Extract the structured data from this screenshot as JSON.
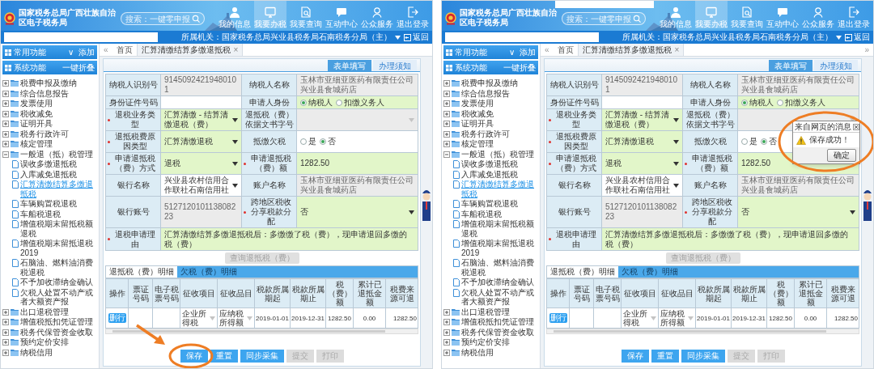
{
  "screens": [
    {
      "header": {
        "title": "国家税务总局广西壮族自治区电子税务局",
        "search_placeholder": "搜索：一键零申报",
        "redacted": false,
        "nav": [
          {
            "label": "我的信息",
            "selected": false
          },
          {
            "label": "我要办税",
            "selected": true
          },
          {
            "label": "我要查询",
            "selected": false
          },
          {
            "label": "互动中心",
            "selected": false
          },
          {
            "label": "公众服务",
            "selected": false
          },
          {
            "label": "退出登录",
            "selected": false
          }
        ]
      },
      "org_bar": {
        "label": "所属机关：国家税务总局兴业县税务局石南税务分局（主）",
        "action": "返回"
      },
      "sidebar": {
        "common": {
          "title": "常用功能",
          "caret": "∨",
          "action": "添加"
        },
        "system": {
          "title": "系统功能",
          "action": "一键折叠"
        },
        "tree": [
          {
            "label": "税费申报及缴纳",
            "expanded": false,
            "selected": false
          },
          {
            "label": "综合信息报告",
            "expanded": false,
            "selected": false
          },
          {
            "label": "发票使用",
            "expanded": false,
            "selected": false
          },
          {
            "label": "税收减免",
            "expanded": false,
            "selected": false
          },
          {
            "label": "证明开具",
            "expanded": false,
            "selected": false
          },
          {
            "label": "税务行政许可",
            "expanded": false,
            "selected": false
          },
          {
            "label": "核定管理",
            "expanded": false,
            "selected": false
          },
          {
            "label": "一般退（抵）税管理",
            "expanded": true,
            "selected": false,
            "children": [
              {
                "label": "误收多缴退抵税",
                "selected": false
              },
              {
                "label": "入库减免退抵税",
                "selected": false
              },
              {
                "label": "汇算清缴结算多缴退抵税",
                "selected": true
              },
              {
                "label": "车辆购置税退税",
                "selected": false
              },
              {
                "label": "车船税退税",
                "selected": false
              },
              {
                "label": "增值税期末留抵税额退税",
                "selected": false
              },
              {
                "label": "增值税期末留抵退税2019",
                "selected": false
              },
              {
                "label": "石脑油、燃料油消费税退税",
                "selected": false
              },
              {
                "label": "不予加收滞纳金确认",
                "selected": false
              },
              {
                "label": "欠税人处置不动产或者大额资产报",
                "selected": false
              }
            ]
          },
          {
            "label": "出口退税管理",
            "expanded": false,
            "selected": false
          },
          {
            "label": "增值税抵扣凭证管理",
            "expanded": false,
            "selected": false
          },
          {
            "label": "税务代保管资金收取",
            "expanded": false,
            "selected": false
          },
          {
            "label": "预约定价安排",
            "expanded": false,
            "selected": false
          },
          {
            "label": "纳税信用",
            "expanded": false,
            "selected": false
          }
        ]
      },
      "tabs": {
        "prev": "«",
        "items": [
          {
            "label": "首页",
            "selected": false
          },
          {
            "label": "汇算清缴结算多缴退抵税",
            "selected": true,
            "close": "×"
          }
        ]
      },
      "form_tabs": [
        {
          "label": "表单填写",
          "selected": true
        },
        {
          "label": "办理须知",
          "selected": false
        }
      ],
      "form": {
        "rows": [
          [
            {
              "label": "纳税人识别号",
              "required": false,
              "kind": "readonly",
              "value": "91450924219480101"
            },
            {
              "label": "纳税人名称",
              "required": false,
              "kind": "readonly",
              "value": "玉林市亚细亚医药有限责任公司兴业县食城药店"
            }
          ],
          [
            {
              "label": "身份证件号码",
              "required": false,
              "kind": "input",
              "highlight": false
            },
            {
              "label": "申请人身份",
              "required": false,
              "kind": "radio",
              "highlight": true,
              "options": [
                {
                  "label": "纳税人",
                  "checked": true
                },
                {
                  "label": "扣缴义务人",
                  "checked": false
                }
              ]
            }
          ],
          [
            {
              "label": "退税业务类型",
              "required": true,
              "kind": "select",
              "highlight": true,
              "disabled": false,
              "value": "汇算清缴 - 结算清缴退税（费）"
            },
            {
              "label": "退抵税（费）依据文书字号",
              "required": false,
              "kind": "select",
              "highlight": false,
              "disabled": true
            }
          ],
          [
            {
              "label": "退抵税费原因类型",
              "required": true,
              "kind": "select",
              "highlight": true,
              "disabled": false,
              "value": "汇算清缴退税"
            },
            {
              "label": "抵缴欠税",
              "required": false,
              "kind": "radio",
              "highlight": false,
              "options": [
                {
                  "label": "是",
                  "checked": false
                },
                {
                  "label": "否",
                  "checked": true
                }
              ]
            }
          ],
          [
            {
              "label": "申请退抵税（费）方式",
              "required": true,
              "kind": "select",
              "highlight": true,
              "disabled": false,
              "value": "退税"
            },
            {
              "label": "申请退抵税（费）额",
              "required": true,
              "kind": "input",
              "highlight": true,
              "value": "1282.50"
            }
          ],
          [
            {
              "label": "银行名称",
              "required": false,
              "kind": "select",
              "highlight": false,
              "disabled": false,
              "value": "兴业县农村信用合作联社石南信用社"
            },
            {
              "label": "账户名称",
              "required": false,
              "kind": "readonly",
              "value": "玉林市亚细亚医药有限责任公司兴业县食城药店"
            }
          ],
          [
            {
              "label": "银行账号",
              "required": false,
              "kind": "readonly",
              "value": "512712010113808223"
            },
            {
              "label": "跨地区税收分享税款分配",
              "required": true,
              "kind": "select",
              "highlight": true,
              "disabled": false,
              "value": "否"
            }
          ],
          [
            {
              "label": "退税申请理由",
              "required": true,
              "kind": "textarea",
              "highlight": true,
              "value": "汇算清缴结算多缴退抵税后：多缴缴了税（费），现申请退回多缴的税（费）"
            }
          ]
        ]
      },
      "query_button": {
        "label": "查询退抵税（费）",
        "disabled": true
      },
      "detail_tabs": [
        {
          "label": "退抵税（费）明细",
          "selected": true
        },
        {
          "label": "欠税（费）明细",
          "selected": false
        }
      ],
      "table": {
        "columns": [
          "操作",
          "票证号码",
          "电子税票号码",
          "征收项目",
          "征收品目",
          "税款所属期起",
          "税款所属期止",
          "税（费）额",
          "累计已退抵金额",
          "税费来源可退"
        ],
        "rows": [
          {
            "action": "删行",
            "levy_item": "企业所得税",
            "levy_subitem": "应纳税所得额",
            "period_start": "2019-01-01",
            "period_end": "2019-12-31",
            "amount": "1282.50",
            "refunded": "0.00",
            "refundable": "1282.50"
          }
        ]
      },
      "buttons": [
        {
          "label": "保存",
          "disabled": false
        },
        {
          "label": "重置",
          "disabled": false
        },
        {
          "label": "同步采集",
          "disabled": false
        },
        {
          "label": "提交",
          "disabled": true
        },
        {
          "label": "打印",
          "disabled": true
        }
      ],
      "annotation": {
        "kind": "button_callout"
      }
    },
    {
      "header": {
        "title": "国家税务总局广西壮族自治区电子税务局",
        "search_placeholder": "搜索：一键零申报",
        "redacted": true,
        "nav": [
          {
            "label": "我的信息",
            "selected": false
          },
          {
            "label": "我要办税",
            "selected": true
          },
          {
            "label": "我要查询",
            "selected": false
          },
          {
            "label": "互动中心",
            "selected": false
          },
          {
            "label": "公众服务",
            "selected": false
          },
          {
            "label": "退出登录",
            "selected": false
          }
        ]
      },
      "org_bar": {
        "label": "所属机关：国家税务总局兴业县税务局石南税务分局（主）",
        "action": "返回"
      },
      "sidebar": {
        "common": {
          "title": "常用功能",
          "caret": "∨",
          "action": "添加"
        },
        "system": {
          "title": "系统功能",
          "action": "一键折叠"
        },
        "tree": [
          {
            "label": "税费申报及缴纳",
            "expanded": false,
            "selected": false
          },
          {
            "label": "综合信息报告",
            "expanded": false,
            "selected": false
          },
          {
            "label": "发票使用",
            "expanded": false,
            "selected": false
          },
          {
            "label": "税收减免",
            "expanded": false,
            "selected": false
          },
          {
            "label": "证明开具",
            "expanded": false,
            "selected": false
          },
          {
            "label": "税务行政许可",
            "expanded": false,
            "selected": false
          },
          {
            "label": "核定管理",
            "expanded": false,
            "selected": false
          },
          {
            "label": "一般退（抵）税管理",
            "expanded": true,
            "selected": false,
            "children": [
              {
                "label": "误收多缴退抵税",
                "selected": false
              },
              {
                "label": "入库减免退抵税",
                "selected": false
              },
              {
                "label": "汇算清缴结算多缴退抵税",
                "selected": true
              },
              {
                "label": "车辆购置税退税",
                "selected": false
              },
              {
                "label": "车船税退税",
                "selected": false
              },
              {
                "label": "增值税期末留抵税额退税",
                "selected": false
              },
              {
                "label": "增值税期末留抵退税2019",
                "selected": false
              },
              {
                "label": "石脑油、燃料油消费税退税",
                "selected": false
              },
              {
                "label": "不予加收滞纳金确认",
                "selected": false
              },
              {
                "label": "欠税人处置不动产或者大额资产报",
                "selected": false
              }
            ]
          },
          {
            "label": "出口退税管理",
            "expanded": false,
            "selected": false
          },
          {
            "label": "增值税抵扣凭证管理",
            "expanded": false,
            "selected": false
          },
          {
            "label": "税务代保管资金收取",
            "expanded": false,
            "selected": false
          },
          {
            "label": "预约定价安排",
            "expanded": false,
            "selected": false
          },
          {
            "label": "纳税信用",
            "expanded": false,
            "selected": false
          }
        ]
      },
      "tabs": {
        "prev": "«",
        "next": "»",
        "items": [
          {
            "label": "首页",
            "selected": false
          },
          {
            "label": "汇算清缴结算多缴退抵税",
            "selected": true,
            "close": "×"
          }
        ]
      },
      "form_tabs": [
        {
          "label": "表单填写",
          "selected": true
        },
        {
          "label": "办理须知",
          "selected": false
        }
      ],
      "form": {
        "rows": [
          [
            {
              "label": "纳税人识别号",
              "required": false,
              "kind": "readonly",
              "value": "91450924219480101"
            },
            {
              "label": "纳税人名称",
              "required": false,
              "kind": "readonly",
              "value": "玉林市亚细亚医药有限责任公司兴业县食城药店"
            }
          ],
          [
            {
              "label": "身份证件号码",
              "required": false,
              "kind": "input",
              "highlight": false
            },
            {
              "label": "申请人身份",
              "required": false,
              "kind": "radio",
              "highlight": true,
              "options": [
                {
                  "label": "纳税人",
                  "checked": true
                },
                {
                  "label": "扣缴义务人",
                  "checked": false
                }
              ]
            }
          ],
          [
            {
              "label": "退税业务类型",
              "required": true,
              "kind": "select",
              "highlight": true,
              "disabled": false,
              "value": "汇算清缴 - 结算清缴退税（费）"
            },
            {
              "label": "退抵税（费）依据文书字号",
              "required": false,
              "kind": "select",
              "highlight": false,
              "disabled": true
            }
          ],
          [
            {
              "label": "退抵税费原因类型",
              "required": true,
              "kind": "select",
              "highlight": true,
              "disabled": false,
              "value": "汇算清缴退税"
            },
            {
              "label": "抵缴欠税",
              "required": false,
              "kind": "radio",
              "highlight": false,
              "options": [
                {
                  "label": "是",
                  "checked": false
                },
                {
                  "label": "否",
                  "checked": true
                }
              ]
            }
          ],
          [
            {
              "label": "申请退抵税（费）方式",
              "required": true,
              "kind": "select",
              "highlight": true,
              "disabled": false,
              "value": "退税"
            },
            {
              "label": "申请退抵税（费）额",
              "required": true,
              "kind": "input",
              "highlight": true,
              "value": "1282.50"
            }
          ],
          [
            {
              "label": "银行名称",
              "required": false,
              "kind": "select",
              "highlight": false,
              "disabled": false,
              "value": "兴业县农村信用合作联社石南信用社"
            },
            {
              "label": "账户名称",
              "required": false,
              "kind": "readonly",
              "value": "玉林市亚细亚医药有限责任公司兴业县食城药店"
            }
          ],
          [
            {
              "label": "银行账号",
              "required": false,
              "kind": "readonly",
              "value": "512712010113808223"
            },
            {
              "label": "跨地区税收分享税款分配",
              "required": true,
              "kind": "select",
              "highlight": true,
              "disabled": false,
              "value": "否"
            }
          ],
          [
            {
              "label": "退税申请理由",
              "required": true,
              "kind": "textarea",
              "highlight": true,
              "value": "汇算清缴结算多缴退抵税后：多缴缴了税（费），现申请退回多缴的税（费）"
            }
          ]
        ]
      },
      "query_button": {
        "label": "查询退抵税（费）",
        "disabled": true
      },
      "detail_tabs": [
        {
          "label": "退抵税（费）明细",
          "selected": true
        },
        {
          "label": "欠税（费）明细",
          "selected": false
        }
      ],
      "table": {
        "columns": [
          "操作",
          "票证号码",
          "电子税票号码",
          "征收项目",
          "征收品目",
          "税款所属期起",
          "税款所属期止",
          "税（费）额",
          "累计已退抵金额",
          "税费来源可退"
        ],
        "rows": [
          {
            "action": "删行",
            "levy_item": "企业所得税",
            "levy_subitem": "应纳税所得额",
            "period_start": "2019-01-01",
            "period_end": "2019-12-31",
            "amount": "1282.50",
            "refunded": "0.00",
            "refundable": "1282.50"
          }
        ]
      },
      "buttons": [
        {
          "label": "保存",
          "disabled": false
        },
        {
          "label": "重置",
          "disabled": false
        },
        {
          "label": "同步采集",
          "disabled": false
        },
        {
          "label": "提交",
          "disabled": true
        },
        {
          "label": "打印",
          "disabled": true
        }
      ],
      "dialog": {
        "title": "来自网页的消息",
        "message": "保存成功！",
        "button": "确定"
      },
      "annotation": {
        "kind": "dialog_callout"
      }
    }
  ]
}
